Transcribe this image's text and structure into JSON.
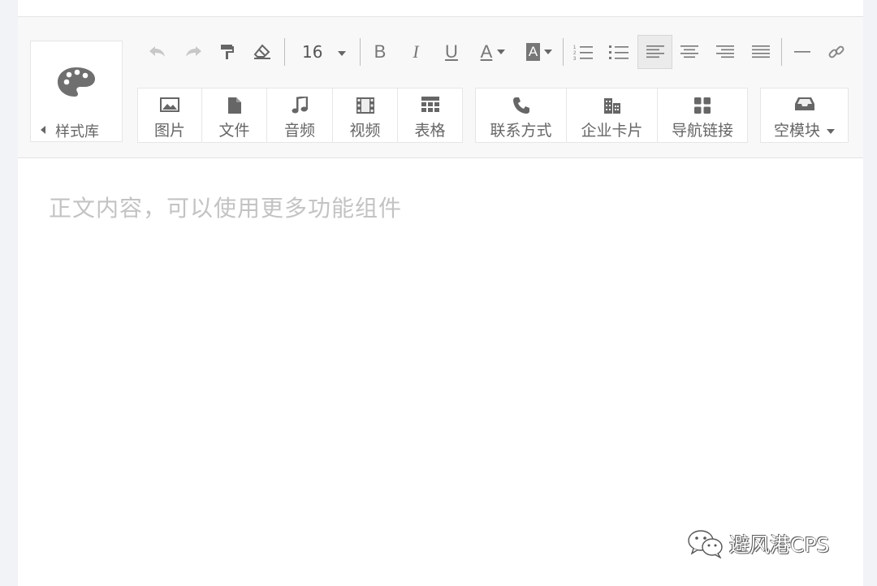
{
  "toolbar": {
    "style_library_label": "样式库",
    "font_size": "16",
    "bold_label": "B",
    "italic_label": "I",
    "underline_label": "U",
    "font_color_label": "A",
    "bg_color_label": "A",
    "insert_groups": [
      {
        "items": [
          "图片",
          "文件",
          "音频",
          "视频",
          "表格"
        ]
      },
      {
        "items": [
          "联系方式",
          "企业卡片",
          "导航链接"
        ]
      },
      {
        "items": [
          "空模块"
        ]
      }
    ]
  },
  "editor": {
    "placeholder": "正文内容，可以使用更多功能组件"
  },
  "watermark": {
    "text": "避风港CPS"
  },
  "icons": {
    "undo": "undo-icon",
    "redo": "redo-icon",
    "format_painter": "paint-roller-icon",
    "eraser": "eraser-icon",
    "ordered_list": "ordered-list-icon",
    "unordered_list": "unordered-list-icon",
    "align_left": "align-left-icon",
    "align_center": "align-center-icon",
    "align_right": "align-right-icon",
    "justify": "justify-icon",
    "hr": "horizontal-rule-icon",
    "link": "link-icon"
  }
}
